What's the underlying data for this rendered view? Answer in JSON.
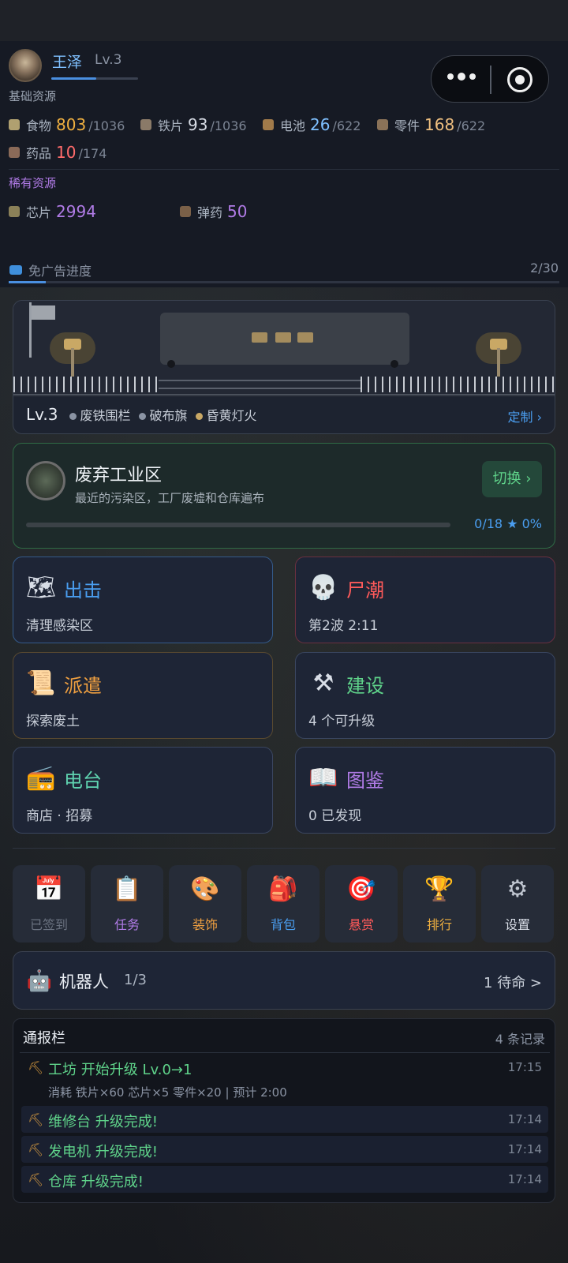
{
  "player": {
    "name": "王泽",
    "level": "Lv.3",
    "xp_fraction": 0.52
  },
  "resources": {
    "basic_label": "基础资源",
    "basic": [
      {
        "name": "食物",
        "value": "803",
        "max": "/1036",
        "value_color": "#f0b040",
        "icon": "food-icon",
        "icon_color": "#b0a070"
      },
      {
        "name": "铁片",
        "value": "93",
        "max": "/1036",
        "value_color": "#d8dde6",
        "icon": "iron-icon",
        "icon_color": "#8a7a68"
      },
      {
        "name": "电池",
        "value": "26",
        "max": "/622",
        "value_color": "#7fc0ff",
        "icon": "battery-icon",
        "icon_color": "#a07a4a"
      },
      {
        "name": "零件",
        "value": "168",
        "max": "/622",
        "value_color": "#f0c080",
        "icon": "parts-icon",
        "icon_color": "#8a7258"
      },
      {
        "name": "药品",
        "value": "10",
        "max": "/174",
        "value_color": "#ff6b6b",
        "icon": "medicine-icon",
        "icon_color": "#8a6a58"
      }
    ],
    "rare_label": "稀有资源",
    "rare": [
      {
        "name": "芯片",
        "value": "2994",
        "value_color": "#b07be6",
        "icon": "chip-icon",
        "icon_color": "#8a8058"
      },
      {
        "name": "弹药",
        "value": "50",
        "value_color": "#b07be6",
        "icon": "ammo-icon",
        "icon_color": "#7a6048"
      }
    ]
  },
  "ad_progress": {
    "label": "免广告进度",
    "count": "2/30",
    "fraction": 0.0667
  },
  "base": {
    "level": "Lv.3",
    "decorations": [
      {
        "label": "废铁围栏",
        "color": "#8a93a3"
      },
      {
        "label": "破布旗",
        "color": "#8a93a3"
      },
      {
        "label": "昏黄灯火",
        "color": "#c9a865"
      }
    ],
    "customize_label": "定制 ›"
  },
  "zone": {
    "title": "废弃工业区",
    "desc": "最近的污染区，工厂废墟和仓库遍布",
    "switch_label": "切换 ›",
    "progress_text": "0/18 ★  0%",
    "fraction": 0
  },
  "tiles": [
    {
      "title": "出击",
      "sub": "清理感染区",
      "icon": "map-icon",
      "glyph": "🗺",
      "title_color": "#4a9ef0",
      "border": "#345a8a"
    },
    {
      "title": "尸潮",
      "sub": "第2波 2:11",
      "icon": "skull-icon",
      "glyph": "💀",
      "title_color": "#ff5a5a",
      "border": "#6a3040"
    },
    {
      "title": "派遣",
      "sub": "探索废土",
      "icon": "scroll-icon",
      "glyph": "📜",
      "title_color": "#f0a040",
      "border": "#5a4a30"
    },
    {
      "title": "建设",
      "sub": "4 个可升级",
      "icon": "tools-icon",
      "glyph": "⚒",
      "title_color": "#5fd38a",
      "border": "#3a4660"
    },
    {
      "title": "电台",
      "sub": "商店 · 招募",
      "icon": "radio-icon",
      "glyph": "📻",
      "title_color": "#5fd3b0",
      "border": "#3a4660"
    },
    {
      "title": "图鉴",
      "sub": "0 已发现",
      "icon": "book-icon",
      "glyph": "📖",
      "title_color": "#b07be6",
      "border": "#3a4660"
    }
  ],
  "quick": [
    {
      "label": "已签到",
      "icon": "calendar-icon",
      "glyph": "📅",
      "color": "#6a7280"
    },
    {
      "label": "任务",
      "icon": "clipboard-icon",
      "glyph": "📋",
      "color": "#b07be6"
    },
    {
      "label": "装饰",
      "icon": "palette-icon",
      "glyph": "🎨",
      "color": "#f0a040"
    },
    {
      "label": "背包",
      "icon": "backpack-icon",
      "glyph": "🎒",
      "color": "#4a9ef0"
    },
    {
      "label": "悬赏",
      "icon": "target-icon",
      "glyph": "🎯",
      "color": "#ff5a5a"
    },
    {
      "label": "排行",
      "icon": "trophy-icon",
      "glyph": "🏆",
      "color": "#f0b040"
    },
    {
      "label": "设置",
      "icon": "gear-icon",
      "glyph": "⚙",
      "color": "#d8dde6"
    }
  ],
  "robot": {
    "title": "机器人",
    "count": "1/3",
    "status": "1 待命 >"
  },
  "log": {
    "title": "通报栏",
    "count": "4 条记录",
    "entries": [
      {
        "text": "工坊 开始升级 Lv.0→1",
        "time": "17:15",
        "detail": "消耗 铁片×60 芯片×5 零件×20 | 预计 2:00"
      },
      {
        "text": "维修台 升级完成!",
        "time": "17:14",
        "detail": ""
      },
      {
        "text": "发电机 升级完成!",
        "time": "17:14",
        "detail": ""
      },
      {
        "text": "仓库 升级完成!",
        "time": "17:14",
        "detail": ""
      }
    ]
  }
}
